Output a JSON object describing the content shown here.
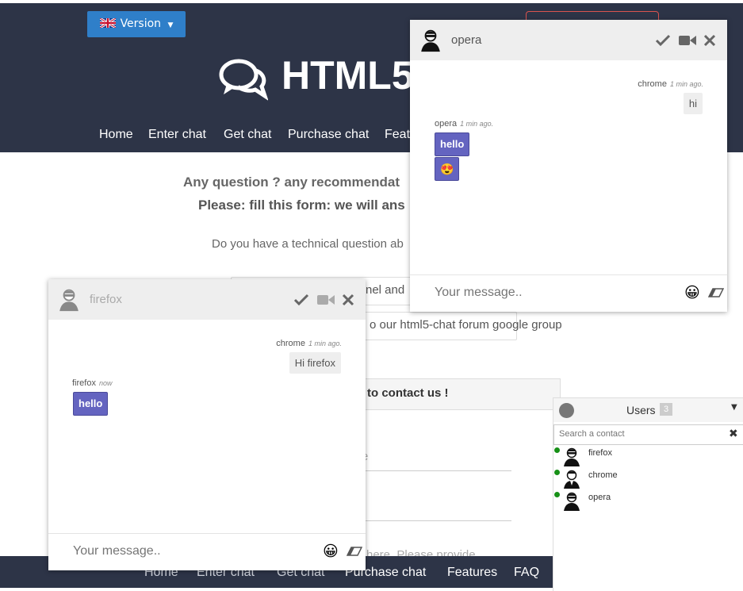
{
  "header": {
    "version_label": "Version",
    "site_title": "HTML5",
    "nav": [
      "Home",
      "Enter chat",
      "Get chat",
      "Purchase chat",
      "Featu"
    ]
  },
  "page": {
    "question_line1": "Any question ? any recommendat",
    "question_line2": "Please: fill this form: we will ans",
    "question_line3": "Do you have a technical question ab",
    "link1_text": "nel and",
    "link2_text": "o our html5-chat forum google group",
    "contact_title": "to contact us !",
    "form_placeholder1": "e",
    "form_placeholder2": "here. Please provide"
  },
  "footer_nav": [
    "Home",
    "Enter chat",
    "Get chat",
    "Purchase chat",
    "Features",
    "FAQ"
  ],
  "chat_opera": {
    "username": "opera",
    "messages": [
      {
        "from": "chrome",
        "time": "1 min ago.",
        "text": "hi"
      },
      {
        "from": "opera",
        "time": "1 min ago.",
        "text": "hello"
      }
    ],
    "emoji_message": "😍",
    "input_placeholder": "Your message.."
  },
  "chat_firefox": {
    "username": "firefox",
    "messages": [
      {
        "from": "chrome",
        "time": "1 min ago.",
        "text": "Hi firefox"
      },
      {
        "from": "firefox",
        "time": "now",
        "text": "hello"
      }
    ],
    "input_placeholder": "Your message.."
  },
  "users": {
    "title": "Users",
    "count": "3",
    "search_placeholder": "Search a contact",
    "list": [
      {
        "name": "firefox",
        "online": true
      },
      {
        "name": "chrome",
        "online": true
      },
      {
        "name": "opera",
        "online": true
      }
    ]
  },
  "colors": {
    "header_bg": "#2d3447",
    "accent_blue": "#2f7fc9",
    "bubble_out": "#6464c0",
    "online": "#179017"
  }
}
